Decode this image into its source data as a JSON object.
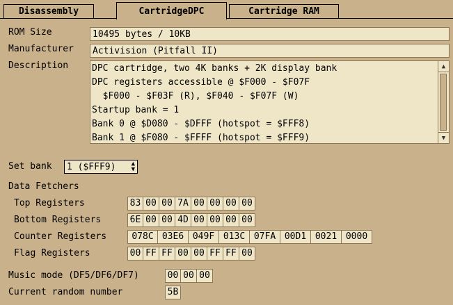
{
  "tabs": [
    {
      "label": "Disassembly",
      "active": false
    },
    {
      "label": "CartridgeDPC",
      "active": true
    },
    {
      "label": "Cartridge RAM",
      "active": false
    }
  ],
  "rom_size": {
    "label": "ROM Size",
    "value": "10495 bytes / 10KB"
  },
  "manufacturer": {
    "label": "Manufacturer",
    "value": "Activision (Pitfall II)"
  },
  "description": {
    "label": "Description",
    "lines": [
      "DPC cartridge, two 4K banks + 2K display bank",
      "DPC registers accessible @ $F000 - $F07F",
      "  $F000 - $F03F (R), $F040 - $F07F (W)",
      "Startup bank = 1",
      "Bank 0 @ $D080 - $DFFF (hotspot = $FFF8)",
      "Bank 1 @ $F080 - $FFFF (hotspot = $FFF9)"
    ]
  },
  "set_bank": {
    "label": "Set bank",
    "value": "1 ($FFF9)"
  },
  "data_fetchers": {
    "label": "Data Fetchers",
    "top": {
      "label": "Top Registers",
      "values": [
        "83",
        "00",
        "00",
        "7A",
        "00",
        "00",
        "00",
        "00"
      ]
    },
    "bottom": {
      "label": "Bottom Registers",
      "values": [
        "6E",
        "00",
        "00",
        "4D",
        "00",
        "00",
        "00",
        "00"
      ]
    },
    "counter": {
      "label": "Counter Registers",
      "values": [
        "078C",
        "03E6",
        "049F",
        "013C",
        "07FA",
        "00D1",
        "0021",
        "0000"
      ]
    },
    "flag": {
      "label": "Flag Registers",
      "values": [
        "00",
        "FF",
        "FF",
        "00",
        "00",
        "FF",
        "FF",
        "00"
      ]
    }
  },
  "music_mode": {
    "label": "Music mode (DF5/DF6/DF7)",
    "values": [
      "00",
      "00",
      "00"
    ]
  },
  "random": {
    "label": "Current random number",
    "value": "5B"
  }
}
